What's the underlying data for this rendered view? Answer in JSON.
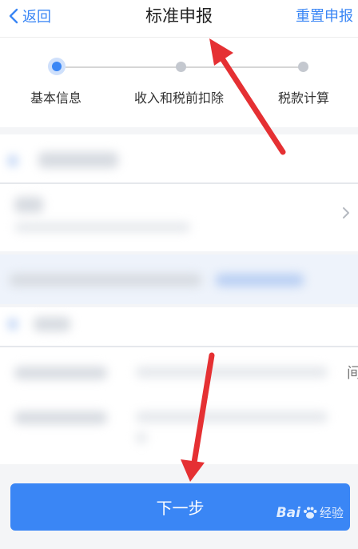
{
  "nav": {
    "back_label": "返回",
    "title": "标准申报",
    "right_action": "重置申报"
  },
  "steps": [
    {
      "label": "基本信息",
      "active": true
    },
    {
      "label": "收入和税前扣除",
      "active": false
    },
    {
      "label": "税款计算",
      "active": false
    }
  ],
  "form_partial_text": "间",
  "next_button_label": "下一步",
  "watermark": {
    "brand_text": "Bai",
    "suffix_text": "经验"
  },
  "colors": {
    "accent": "#3a86f5",
    "annotation_arrow": "#e53033"
  }
}
